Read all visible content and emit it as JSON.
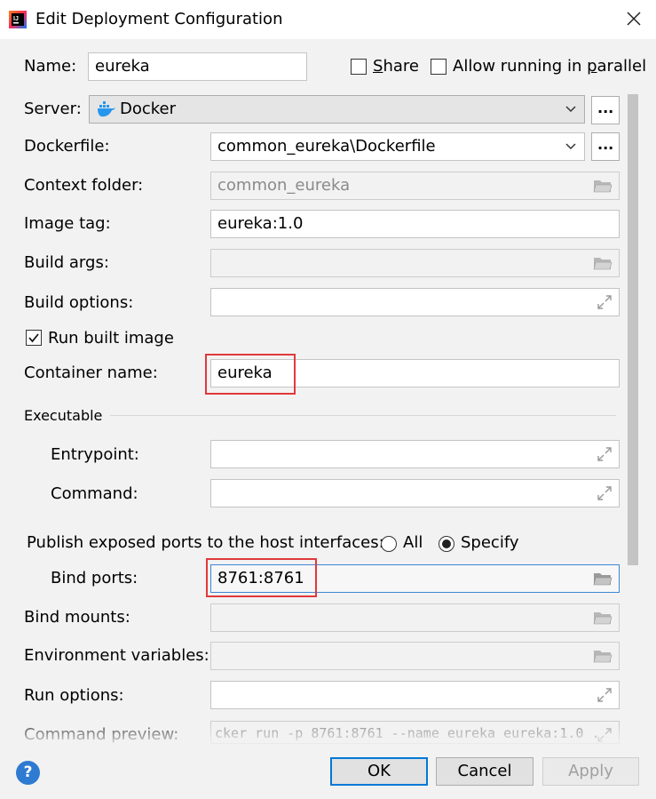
{
  "window": {
    "title": "Edit Deployment Configuration"
  },
  "form": {
    "name_label": "Name:",
    "name_value": "eureka",
    "share_label": "Share",
    "share_checked": false,
    "parallel_label": "Allow running in parallel",
    "parallel_checked": false,
    "server_label": "Server:",
    "server_value": "Docker",
    "dockerfile_label": "Dockerfile:",
    "dockerfile_value": "common_eureka\\Dockerfile",
    "context_label": "Context folder:",
    "context_value": "common_eureka",
    "image_tag_label": "Image tag:",
    "image_tag_value": "eureka:1.0",
    "build_args_label": "Build args:",
    "build_options_label": "Build options:",
    "run_built_label": "Run built image",
    "run_built_checked": true,
    "container_label": "Container name:",
    "container_value": "eureka",
    "executable_label": "Executable",
    "entrypoint_label": "Entrypoint:",
    "command_label": "Command:",
    "publish_label": "Publish exposed ports to the host interfaces:",
    "all_label": "All",
    "specify_label": "Specify",
    "selected_publish": "Specify",
    "bind_ports_label": "Bind ports:",
    "bind_ports_value": "8761:8761",
    "bind_mounts_label": "Bind mounts:",
    "env_label": "Environment variables:",
    "run_options_label": "Run options:",
    "preview_label": "Command preview:",
    "preview_value": "cker run -p 8761:8761 --name eureka eureka:1.0 ."
  },
  "buttons": {
    "dots": "...",
    "ok": "OK",
    "cancel": "Cancel",
    "apply": "Apply",
    "help": "?"
  },
  "colors": {
    "highlight": "#e0393a",
    "focus": "#3d86d6",
    "primary_border": "#0078d7",
    "help_blue": "#2e7bd1",
    "docker_blue": "#2496ed"
  }
}
